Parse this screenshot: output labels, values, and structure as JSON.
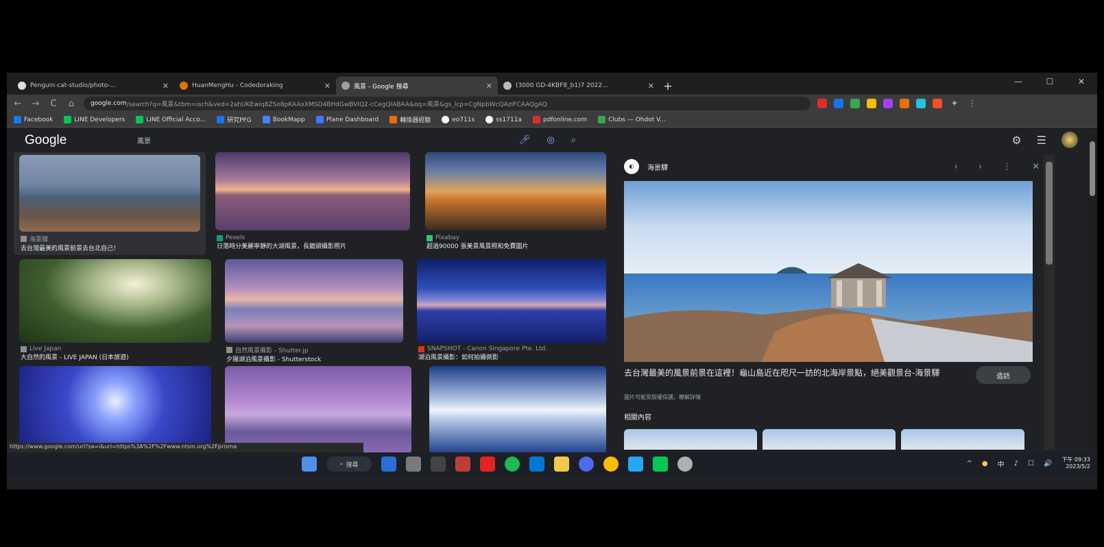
{
  "browser": {
    "tabs": [
      {
        "title": "Penguin-cat-studio/photo-...",
        "favicon_color": "#dddddd",
        "active": false
      },
      {
        "title": "HuanMengHu - Codedoraking",
        "favicon_color": "#e37400",
        "active": false
      },
      {
        "title": "風景 - Google 搜尋",
        "favicon_color": "#9aa0a6",
        "active": true
      },
      {
        "title": "(3000 GD-4KBF8_b1)7 2022...",
        "favicon_color": "#bbbbbb",
        "active": false
      }
    ],
    "new_tab": "+",
    "window_controls": [
      "—",
      "☐",
      "✕"
    ],
    "nav": {
      "back": "←",
      "forward": "→",
      "reload": "C",
      "home": "⌂"
    },
    "url_domain": "google.com",
    "url_rest": "/search?q=風景&tbm=isch&ved=2ahUKEwiq8ZSo8pKAAxXMSD4BHdGwBVIQ2-cCegQIABAA&oq=風景&gs_lcp=CgNpbWcQAzIFCAAQgAQ",
    "extension_colors": [
      "#d93025",
      "#1a73e8",
      "#34a853",
      "#fbbc04",
      "#a142f4",
      "#e8710a",
      "#24c1e0",
      "#f25022"
    ],
    "bookmarks": [
      {
        "label": "Facebook",
        "color": "#1877f2"
      },
      {
        "label": "LINE Developers",
        "color": "#06c755"
      },
      {
        "label": "LINE Official Acco...",
        "color": "#06c755"
      },
      {
        "label": "研究PFG",
        "color": "#1a73e8"
      },
      {
        "label": "BookMapp",
        "color": "#4285f4"
      },
      {
        "label": "Plane Dashboard",
        "color": "#3f76ff"
      },
      {
        "label": "轉換器經驗",
        "color": "#e8710a"
      },
      {
        "label": "eo711s",
        "color": "#ffffff"
      },
      {
        "label": "ss1711a",
        "color": "#ffffff"
      },
      {
        "label": "pdfonline.com",
        "color": "#d93025"
      },
      {
        "label": "Clubs — Ohdot V...",
        "color": "#34a853"
      }
    ]
  },
  "google": {
    "logo": "Google",
    "query": "風景",
    "header_icons": [
      "mic-icon",
      "lens-icon",
      "search-icon"
    ],
    "right_icons": [
      "settings-icon",
      "apps-icon",
      "avatar"
    ]
  },
  "results": [
    {
      "source": "海景驛",
      "title": "去台灣最美的風景前景去台北自己！",
      "selected": true
    },
    {
      "source": "Pexels",
      "title": "日落時分美麗寧靜的大湖風景，長鏡頭攝影照片",
      "selected": false
    },
    {
      "source": "Pixabay",
      "title": "超過90000 張美景風景照和免費圖片",
      "selected": false
    },
    {
      "source": "Live Japan",
      "title": "大自然的風景 - LIVE JAPAN (日本旅遊)",
      "selected": false
    },
    {
      "source": "自然風景攝影 - Shutter.jp",
      "title": "夕陽湖泊風景攝影 - Shutterstock",
      "selected": false
    },
    {
      "source": "SNAPSHOT - Canon Singapore Pte. Ltd.",
      "title": "湖泊風景攝影：如何拍攝倒影",
      "selected": false
    },
    {
      "source": "",
      "title": "",
      "selected": false
    },
    {
      "source": "",
      "title": "",
      "selected": false
    },
    {
      "source": "",
      "title": "",
      "selected": false
    }
  ],
  "status_url": "https://www.google.com/url?sa=i&url=https%3A%2F%2Fwww.ntsm.org%2Fprisma",
  "panel": {
    "source": "海景驛",
    "toolbar": [
      "‹",
      "›",
      "⋮",
      "✕"
    ],
    "title": "去台灣最美的風景前景在這裡！龜山島近在咫尺一訪的北海岸景點，絕美觀景台-海景驛",
    "meta": "圖片可能受版權保護。瞭解詳情",
    "visit_label": "造訪",
    "related_label": "相關內容"
  },
  "taskbar": {
    "search_label": "搜尋",
    "app_colors": [
      "#4f8fe8",
      "#2b2b2b",
      "#7a7a7a",
      "#c23b3b",
      "#e02424",
      "#1db954",
      "#0078d4",
      "#f2c94c",
      "#4f6bed",
      "#fbbc04",
      "#23a9f2",
      "#06c755",
      "#b0b0b0"
    ],
    "tray": [
      "^",
      "●",
      "中",
      "♪",
      "☐",
      "🔊"
    ],
    "time": "下午 09:33",
    "date": "2023/5/2"
  }
}
